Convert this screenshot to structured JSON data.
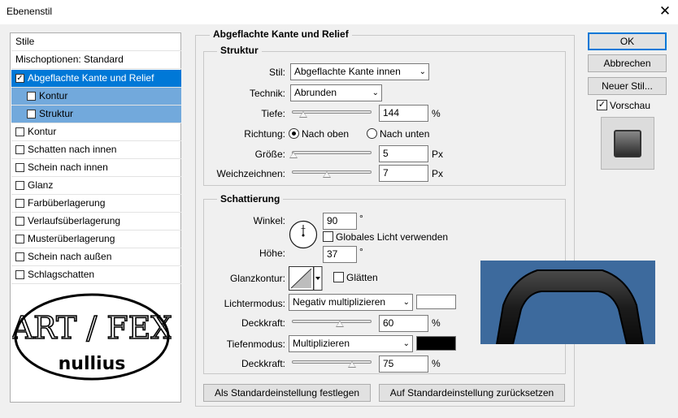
{
  "window": {
    "title": "Ebenenstil",
    "close_glyph": "✕"
  },
  "stylelist": {
    "header": "Stile",
    "blend_options": "Mischoptionen: Standard",
    "items": [
      {
        "label": "Abgeflachte Kante und Relief",
        "checked": true
      },
      {
        "label": "Kontur",
        "checked": false
      },
      {
        "label": "Struktur",
        "checked": false
      },
      {
        "label": "Kontur",
        "checked": false
      },
      {
        "label": "Schatten nach innen",
        "checked": false
      },
      {
        "label": "Schein nach innen",
        "checked": false
      },
      {
        "label": "Glanz",
        "checked": false
      },
      {
        "label": "Farbüberlagerung",
        "checked": false
      },
      {
        "label": "Verlaufsüberlagerung",
        "checked": false
      },
      {
        "label": "Musterüberlagerung",
        "checked": false
      },
      {
        "label": "Schein nach außen",
        "checked": false
      },
      {
        "label": "Schlagschatten",
        "checked": false
      }
    ],
    "checkmark": "✓"
  },
  "logo": {
    "text_top": "ART / FEX",
    "text_bottom": "nullius"
  },
  "bevel": {
    "title": "Abgeflachte Kante und Relief",
    "structure": {
      "title": "Struktur",
      "style_label": "Stil:",
      "style_value": "Abgeflachte Kante innen",
      "technique_label": "Technik:",
      "technique_value": "Abrunden",
      "depth_label": "Tiefe:",
      "depth_value": "144",
      "depth_unit": "%",
      "depth_level": 0.14,
      "direction_label": "Richtung:",
      "direction_up": "Nach oben",
      "direction_down": "Nach unten",
      "size_label": "Größe:",
      "size_value": "5",
      "size_unit": "Px",
      "size_level": 0.02,
      "soften_label": "Weichzeichnen:",
      "soften_value": "7",
      "soften_unit": "Px",
      "soften_level": 0.44
    },
    "shading": {
      "title": "Schattierung",
      "angle_label": "Winkel:",
      "angle_value": "90",
      "angle_unit": "°",
      "global_light_label": "Globales Licht verwenden",
      "altitude_label": "Höhe:",
      "altitude_value": "37",
      "altitude_unit": "°",
      "gloss_label": "Glanzkontur:",
      "smooth_label": "Glätten",
      "highlight_label": "Lichtermodus:",
      "highlight_value": "Negativ multiplizieren",
      "highlight_color": "#ffffff",
      "highlight_opacity_label": "Deckkraft:",
      "highlight_opacity_value": "60",
      "highlight_opacity_unit": "%",
      "highlight_opacity_level": 0.6,
      "shadow_label": "Tiefenmodus:",
      "shadow_value": "Multiplizieren",
      "shadow_color": "#000000",
      "shadow_opacity_label": "Deckkraft:",
      "shadow_opacity_value": "75",
      "shadow_opacity_unit": "%",
      "shadow_opacity_level": 0.75
    },
    "make_default": "Als Standardeinstellung festlegen",
    "reset_default": "Auf Standardeinstellung zurücksetzen"
  },
  "buttons": {
    "ok": "OK",
    "cancel": "Abbrechen",
    "new_style": "Neuer Stil...",
    "preview_label": "Vorschau"
  },
  "colors": {
    "selection": "#0078d7",
    "sub_selection": "#72a9dc",
    "canvas_bg": "#3d6a9d"
  }
}
